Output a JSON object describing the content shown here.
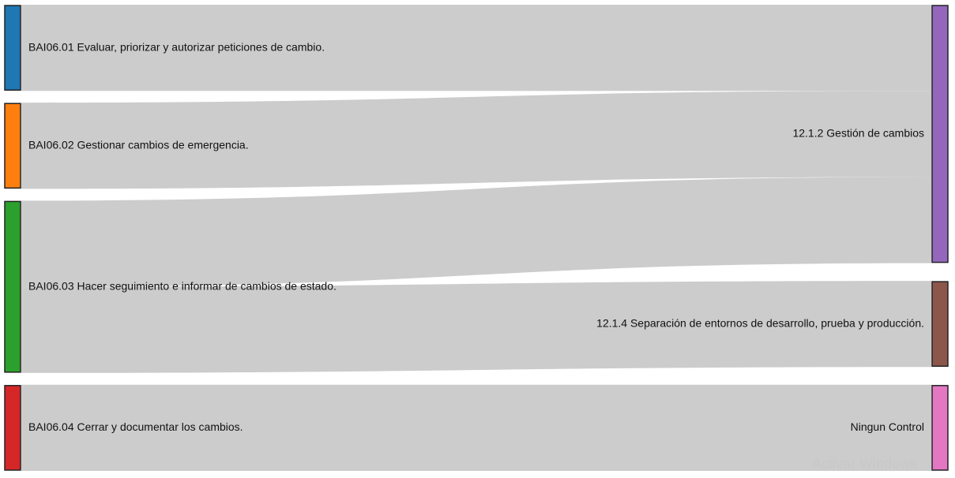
{
  "diagram": {
    "type": "sankey",
    "link_color": "#cccccc",
    "node_border_color": "#222222",
    "left_nodes": [
      {
        "id": "bai0601",
        "label": "BAI06.01 Evaluar, priorizar y autorizar peticiones de cambio.",
        "color": "#1f77b4"
      },
      {
        "id": "bai0602",
        "label": "BAI06.02 Gestionar cambios de emergencia.",
        "color": "#ff7f0e"
      },
      {
        "id": "bai0603",
        "label": "BAI06.03 Hacer seguimiento e informar de cambios de estado.",
        "color": "#2ca02c"
      },
      {
        "id": "bai0604",
        "label": "BAI06.04 Cerrar y documentar los cambios.",
        "color": "#d62728"
      }
    ],
    "right_nodes": [
      {
        "id": "c1212",
        "label": "12.1.2 Gestión de cambios",
        "color": "#9467bd"
      },
      {
        "id": "c1214",
        "label": "12.1.4 Separación de entornos de desarrollo, prueba y producción.",
        "color": "#8c564b"
      },
      {
        "id": "ninguno",
        "label": "Ningun Control",
        "color": "#e377c2"
      }
    ],
    "links": [
      {
        "source": "bai0601",
        "target": "c1212",
        "value": 1
      },
      {
        "source": "bai0602",
        "target": "c1212",
        "value": 1
      },
      {
        "source": "bai0603",
        "target": "c1212",
        "value": 1
      },
      {
        "source": "bai0603",
        "target": "c1214",
        "value": 1
      },
      {
        "source": "bai0604",
        "target": "ninguno",
        "value": 1
      }
    ]
  },
  "os_watermark": {
    "text": "Activar Windows"
  }
}
